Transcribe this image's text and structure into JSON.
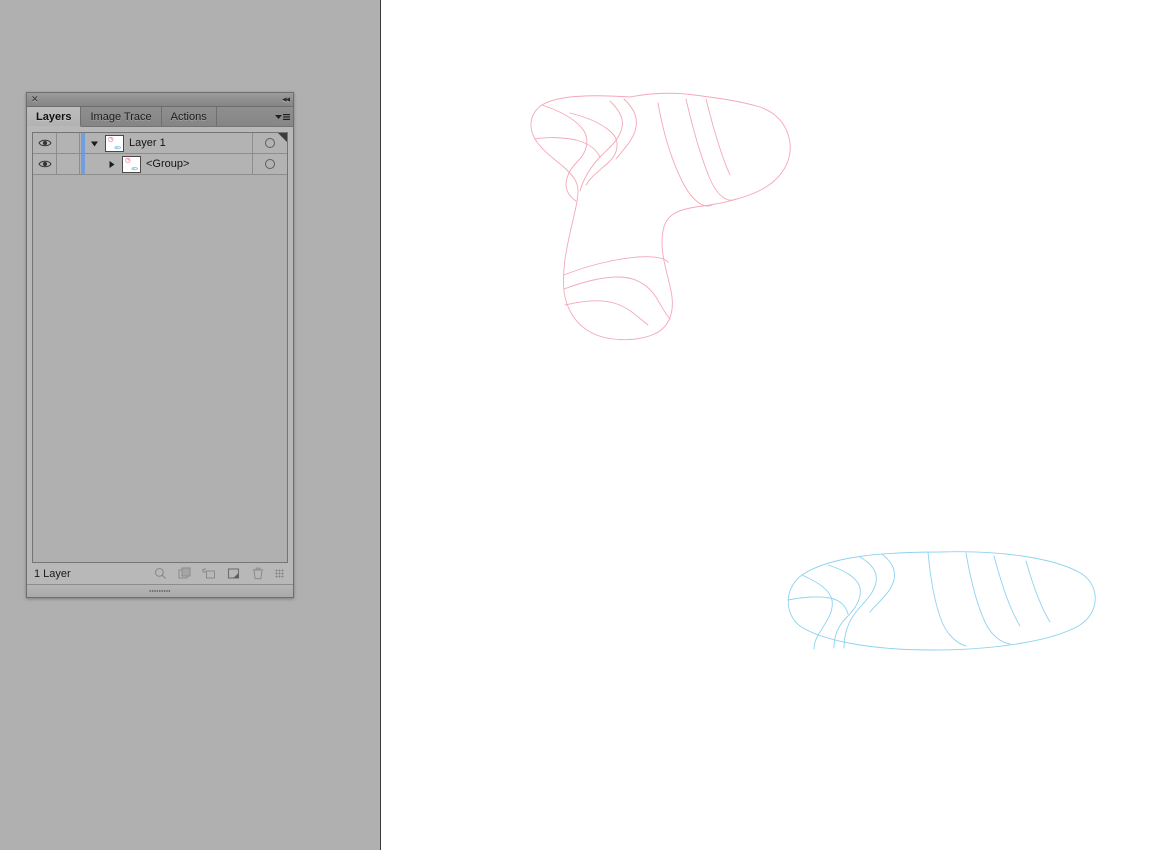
{
  "app": {
    "background_color": "#b0b0b0",
    "canvas_color": "#ffffff"
  },
  "panel": {
    "title_bar": {
      "close_glyph": "✕",
      "close_name": "close-panel",
      "collapse_glyph": "◂◂",
      "collapse_name": "collapse-to-icons"
    },
    "tabs": [
      {
        "label": "Layers",
        "active": true
      },
      {
        "label": "Image Trace",
        "active": false
      },
      {
        "label": "Actions",
        "active": false
      }
    ],
    "menu_icon": "panel-menu-icon",
    "rows": [
      {
        "name": "Layer 1",
        "visible": true,
        "locked": false,
        "expanded": true,
        "disclosure_glyph": "▼",
        "selected": true,
        "indent": false,
        "eye_icon": "eye-icon",
        "target_icon": "target-circle-icon",
        "thumbnail": "layer-thumbnail"
      },
      {
        "name": "<Group>",
        "visible": true,
        "locked": false,
        "expanded": false,
        "disclosure_glyph": "▶",
        "selected": true,
        "indent": true,
        "eye_icon": "eye-icon",
        "target_icon": "target-circle-icon",
        "thumbnail": "group-thumbnail"
      }
    ],
    "footer": {
      "count_label": "1 Layer",
      "icons": [
        {
          "name": "locate-object-icon",
          "title": "Locate Object"
        },
        {
          "name": "clipping-mask-icon",
          "title": "Make/Release Clipping Mask"
        },
        {
          "name": "new-sublayer-icon",
          "title": "Create New Sublayer"
        },
        {
          "name": "new-layer-icon",
          "title": "Create New Layer"
        },
        {
          "name": "delete-layer-icon",
          "title": "Delete Selection"
        }
      ],
      "grip": "resize-grip-icon"
    }
  },
  "artwork": {
    "sock": {
      "stroke_color": "#f4a8b8",
      "label": "sock-outline-path"
    },
    "ellipse": {
      "stroke_color": "#8fd3ef",
      "label": "flattened-ellipse-path"
    }
  }
}
